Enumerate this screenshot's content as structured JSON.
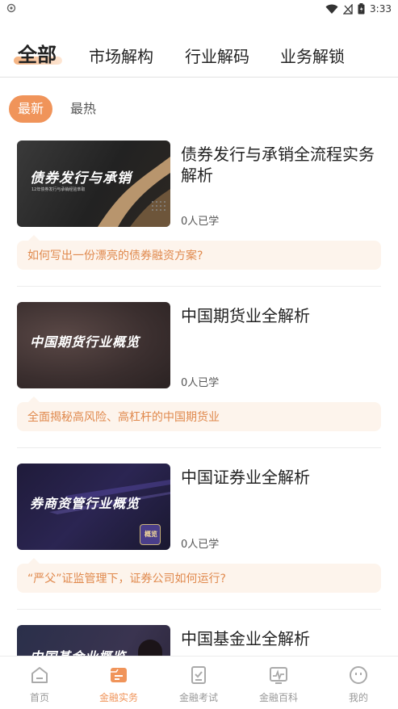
{
  "status_bar": {
    "time": "3:33"
  },
  "top_tabs": [
    {
      "label": "全部"
    },
    {
      "label": "市场解构"
    },
    {
      "label": "行业解码"
    },
    {
      "label": "业务解锁"
    }
  ],
  "filters": [
    {
      "label": "最新"
    },
    {
      "label": "最热"
    }
  ],
  "courses": [
    {
      "thumb_title": "债券发行与承销",
      "thumb_subtitle": "12年债券发行与承销经验萃取",
      "title": "债券发行与承销全流程实务解析",
      "learners": "0人已学",
      "description": "如何写出一份漂亮的债券融资方案?"
    },
    {
      "thumb_title": "中国期货行业概览",
      "title": "中国期货业全解析",
      "learners": "0人已学",
      "description": "全面揭秘高风险、高杠杆的中国期货业"
    },
    {
      "thumb_title": "券商资管行业概览",
      "thumb_badge": "概览",
      "title": "中国证券业全解析",
      "learners": "0人已学",
      "description": "“严父”证监管理下，证券公司如何运行?"
    },
    {
      "thumb_title": "中国基金业概览",
      "title": "中国基金业全解析"
    }
  ],
  "bottom_nav": [
    {
      "label": "首页",
      "icon": "home-icon"
    },
    {
      "label": "金融实务",
      "icon": "practice-icon"
    },
    {
      "label": "金融考试",
      "icon": "exam-icon"
    },
    {
      "label": "金融百科",
      "icon": "encyclopedia-icon"
    },
    {
      "label": "我的",
      "icon": "profile-icon"
    }
  ],
  "colors": {
    "accent": "#f0945a",
    "desc_bg": "#fdf4ec",
    "desc_text": "#e0894d"
  }
}
